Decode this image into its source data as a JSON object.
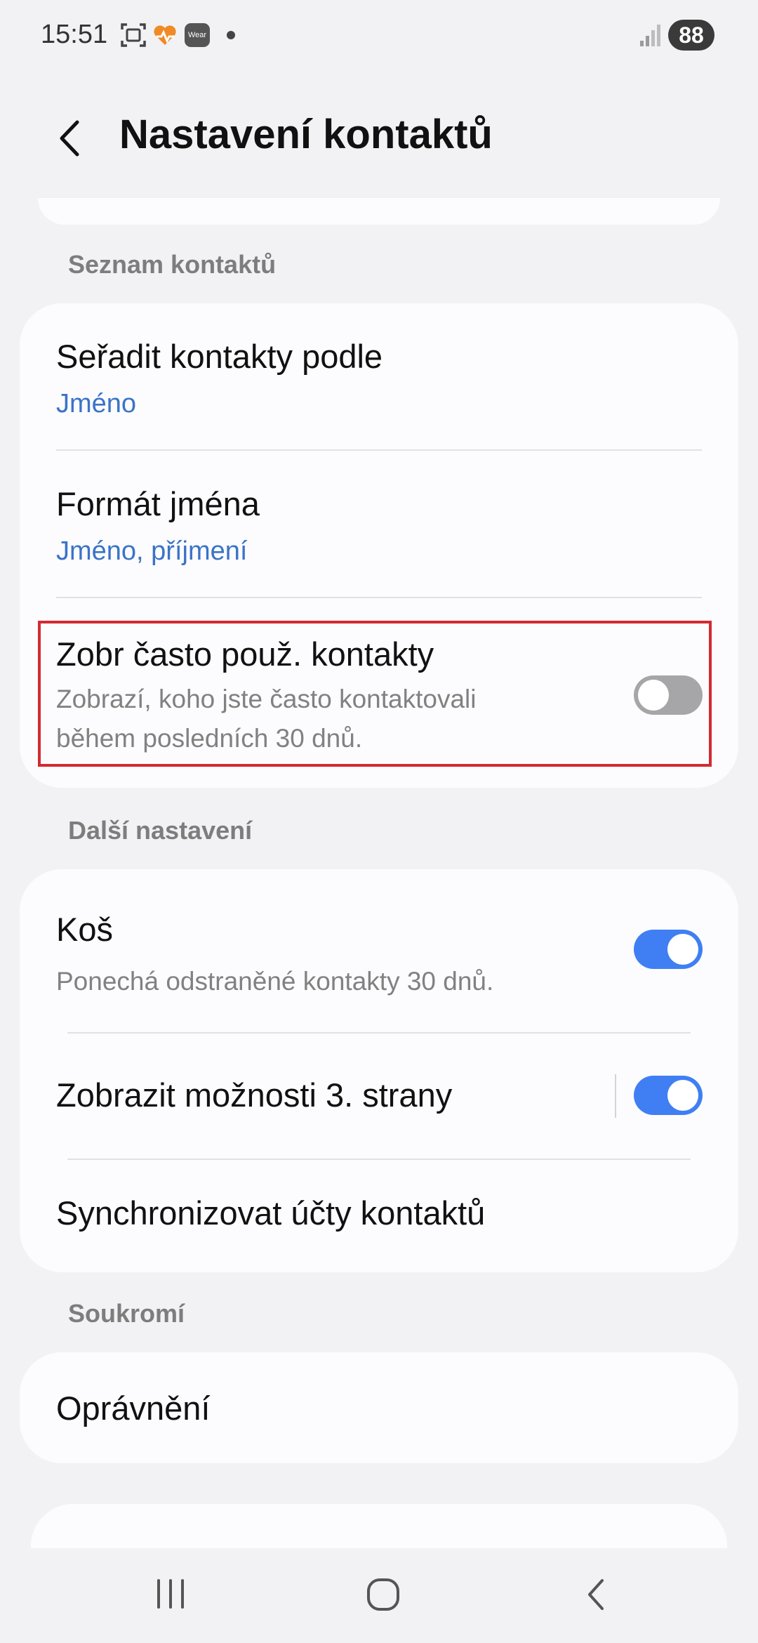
{
  "status_bar": {
    "time": "15:51",
    "wear_label": "Wear",
    "battery": "88",
    "icons": [
      "screenshot-icon",
      "heart-app-icon",
      "wear-icon",
      "notification-dot-icon",
      "signal-icon"
    ]
  },
  "header": {
    "title": "Nastavení kontaktů",
    "back_icon": "chevron-left-icon"
  },
  "sections": {
    "contacts_list": {
      "header": "Seznam kontaktů",
      "sort": {
        "title": "Seřadit kontakty podle",
        "value": "Jméno"
      },
      "name_format": {
        "title": "Formát jména",
        "value": "Jméno, příjmení"
      },
      "frequent": {
        "title": "Zobr často použ. kontakty",
        "description": "Zobrazí, koho jste často kontaktovali během posledních 30 dnů.",
        "enabled": false
      }
    },
    "more_settings": {
      "header": "Další nastavení",
      "trash": {
        "title": "Koš",
        "description": "Ponechá odstraněné kontakty 30 dnů.",
        "enabled": true
      },
      "third_party": {
        "title": "Zobrazit možnosti 3. strany",
        "enabled": true
      },
      "sync": {
        "title": "Synchronizovat účty kontaktů"
      }
    },
    "privacy": {
      "header": "Soukromí",
      "permissions": {
        "title": "Oprávnění"
      }
    }
  },
  "colors": {
    "accent": "#3f7ff3",
    "link": "#3b73c7",
    "highlight": "#d42a32",
    "background": "#f2f2f4",
    "card": "#fcfcfe"
  },
  "nav_bar": {
    "icons": [
      "recent-apps-icon",
      "home-icon",
      "back-icon"
    ]
  }
}
